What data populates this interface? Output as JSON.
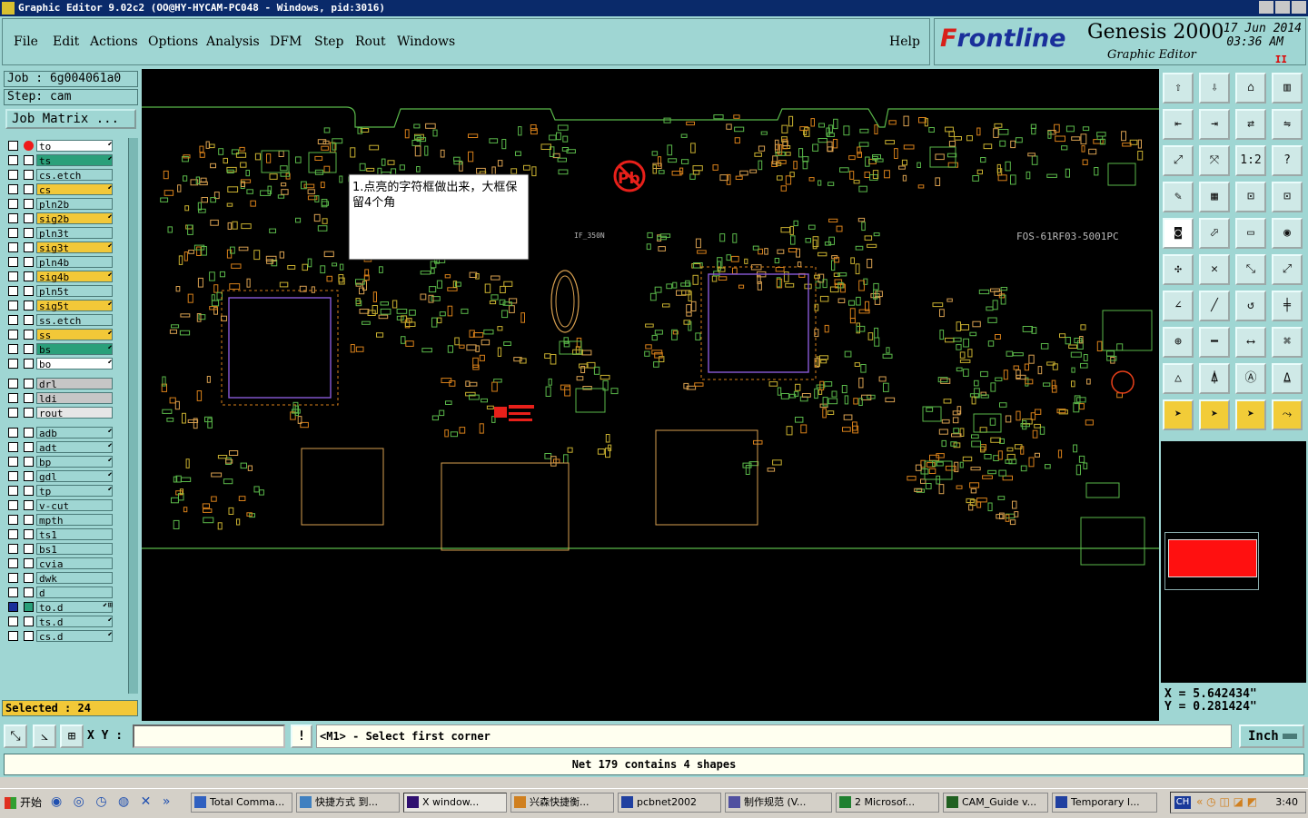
{
  "window": {
    "title": "Graphic Editor 9.02c2 (OO@HY-HYCAM-PC048 - Windows, pid:3016)"
  },
  "menu": [
    "File",
    "Edit",
    "Actions",
    "Options",
    "Analysis",
    "DFM",
    "Step",
    "Rout",
    "Windows"
  ],
  "help_label": "Help",
  "brand": {
    "logo_prefix": "F",
    "logo_rest": "rontline",
    "product": "Genesis 2000",
    "subtitle": "Graphic Editor",
    "date": "17 Jun 2014",
    "time": "03:36 AM",
    "pause": "II"
  },
  "job": {
    "job_label": "Job : 6g004061a0",
    "step_label": "Step: cam",
    "matrix_button": "Job Matrix ..."
  },
  "layers": [
    {
      "name": "to",
      "color": "#ffffff",
      "flag": "⬋",
      "dot": true
    },
    {
      "name": "ts",
      "color": "#2aa07a",
      "flag": "⬋"
    },
    {
      "name": "cs.etch",
      "color": "#9fd6d3",
      "flag": ""
    },
    {
      "name": "cs",
      "color": "#f2c838",
      "flag": "⬋"
    },
    {
      "name": "pln2b",
      "color": "#9fd6d3",
      "flag": ""
    },
    {
      "name": "sig2b",
      "color": "#f2c838",
      "flag": "⬋"
    },
    {
      "name": "pln3t",
      "color": "#9fd6d3",
      "flag": ""
    },
    {
      "name": "sig3t",
      "color": "#f2c838",
      "flag": "⬋"
    },
    {
      "name": "pln4b",
      "color": "#9fd6d3",
      "flag": ""
    },
    {
      "name": "sig4b",
      "color": "#f2c838",
      "flag": "⬋"
    },
    {
      "name": "pln5t",
      "color": "#9fd6d3",
      "flag": ""
    },
    {
      "name": "sig5t",
      "color": "#f2c838",
      "flag": "⬋"
    },
    {
      "name": "ss.etch",
      "color": "#9fd6d3",
      "flag": ""
    },
    {
      "name": "ss",
      "color": "#f2c838",
      "flag": "⬋"
    },
    {
      "name": "bs",
      "color": "#2aa07a",
      "flag": "⬋"
    },
    {
      "name": "bo",
      "color": "#ffffff",
      "flag": "⬋"
    },
    {
      "name": "drl",
      "color": "#c6c6c6",
      "flag": ""
    },
    {
      "name": "ldi",
      "color": "#c6c6c6",
      "flag": ""
    },
    {
      "name": "rout",
      "color": "#e6e6e6",
      "flag": ""
    },
    {
      "name": "adb",
      "color": "#9fd6d3",
      "flag": "⬋"
    },
    {
      "name": "adt",
      "color": "#9fd6d3",
      "flag": "⬋"
    },
    {
      "name": "bp",
      "color": "#9fd6d3",
      "flag": "⬋"
    },
    {
      "name": "gdl",
      "color": "#9fd6d3",
      "flag": "⬋"
    },
    {
      "name": "tp",
      "color": "#9fd6d3",
      "flag": "⬋"
    },
    {
      "name": "v-cut",
      "color": "#9fd6d3",
      "flag": ""
    },
    {
      "name": "mpth",
      "color": "#9fd6d3",
      "flag": ""
    },
    {
      "name": "ts1",
      "color": "#9fd6d3",
      "flag": ""
    },
    {
      "name": "bs1",
      "color": "#9fd6d3",
      "flag": ""
    },
    {
      "name": "cvia",
      "color": "#9fd6d3",
      "flag": ""
    },
    {
      "name": "dwk",
      "color": "#9fd6d3",
      "flag": ""
    },
    {
      "name": "d",
      "color": "#9fd6d3",
      "flag": ""
    },
    {
      "name": "to.d",
      "color": "#9fd6d3",
      "flag": "⬋⊞",
      "work": true
    },
    {
      "name": "ts.d",
      "color": "#9fd6d3",
      "flag": "⬋"
    },
    {
      "name": "cs.d",
      "color": "#9fd6d3",
      "flag": "⬋"
    }
  ],
  "selected_label": "Selected : 24",
  "canvas": {
    "note": "1.点亮的字符框做出来，大框保留4个角",
    "silk_labels": [
      "FOS-61RF03-5001PC",
      "IF_350N"
    ]
  },
  "coords": {
    "x": "X = 5.642434\"",
    "y": "Y = 0.281424\""
  },
  "cmd": {
    "xy_label": "X Y :",
    "xy_value": "",
    "excl": "!",
    "prompt": "<M1> - Select first corner",
    "unit": "Inch"
  },
  "status_text": "Net 179 contains 4 shapes",
  "taskbar": {
    "start": "开始",
    "items": [
      "Total Comma...",
      "快捷方式 到...",
      "X window...",
      "兴森快捷衡...",
      "pcbnet2002",
      "制作规范 (V...",
      "2 Microsof...",
      "CAM_Guide v...",
      "Temporary I..."
    ],
    "lang": "CH",
    "clock": "3:40"
  },
  "colors": {
    "accent_yellow": "#f2c838",
    "panel": "#9fd6d3",
    "silk_red": "#e8401a",
    "pad_green": "#5ab84a",
    "pad_orange": "#d8801a",
    "ic_outline": "#8a5ad8"
  }
}
